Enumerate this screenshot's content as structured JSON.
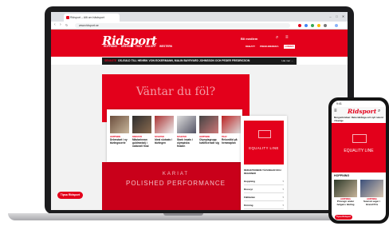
{
  "browser": {
    "tab_title": "Ridsport – Allt om hästsport",
    "url": "www.ridsport.se",
    "back_glyph": "‹",
    "forward_glyph": "›",
    "reload_glyph": "↻",
    "window_minimize": "–",
    "window_maximize": "□",
    "window_close": "✕"
  },
  "site": {
    "logo": "Ridsport",
    "logo_sub": "",
    "become_member": "Bli medlem",
    "search_icon": "⌕",
    "menu_icon": "≡",
    "nav": [
      "HOPPNING",
      "DRESSYR",
      "TRAV",
      "GALOPP",
      "WESTERN"
    ],
    "nav_right": [
      "DEBATT",
      "PRENUMERERA"
    ],
    "login": "LOGGA IN",
    "breaking_label": "SENASTE",
    "breaking_text": "OS-GULD TILL HENRIK VON ECKERMANN, MALIN BAYRYARD JOHNSSON OCH PEDER FREDRICSON",
    "breaking_more": "Läs mer →"
  },
  "ads": {
    "top": "Väntar du föl?",
    "bottom_line1": "KARIAT",
    "bottom_line2": "POLISHED PERFORMANCE"
  },
  "news": [
    {
      "label": "HOPPNING",
      "title": "Drömstart i ny tävlingsserie"
    },
    {
      "label": "DRESSYR",
      "title": "Mästarinnan guldmedalj i nationell final"
    },
    {
      "label": "NYHETER",
      "title": "Ideal slutsats i tävlingen"
    },
    {
      "label": "NYHETER",
      "title": "Stark insats i olympiska finalen"
    },
    {
      "label": "HOPPNING",
      "title": "Olympiagrupp kvalificerade sig"
    },
    {
      "label": "TRAV",
      "title": "Rekordtid på hemmaplan"
    }
  ],
  "sidebar": {
    "ad_text": "EQUALITY LINE",
    "heading": "REDAKTIONENS TÄVLINGAR OCH REGIONER",
    "rows": [
      "Hoppning",
      "Dressyr",
      "Fälttävlan",
      "Körning"
    ]
  },
  "chat_button": "Tipsa Ridsport",
  "phone": {
    "time": "9:41",
    "logo": "Ridsport",
    "headline": "Morgonbrickan: Rekordmånga och nytt rekord i Sverige",
    "ad_text": "EQUALITY LINE",
    "section": "HOPPNING",
    "items": [
      {
        "label": "HOPPNING",
        "title": "Prisregn under helgens tävling"
      },
      {
        "label": "HOPPNING",
        "title": "Svensk seger i Grand Prix"
      }
    ],
    "chat_button": "Tipsa Ridsport"
  },
  "colors": {
    "brand": "#e3001b",
    "dark": "#1a1a1a"
  }
}
